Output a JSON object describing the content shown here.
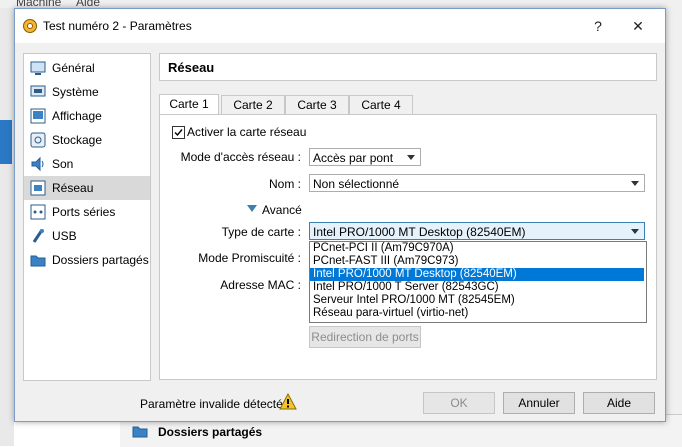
{
  "background_app": {
    "menu_items": [
      "Machine",
      "Aide"
    ],
    "list_footer_item": "Dossiers partagés"
  },
  "dialog": {
    "title": "Test numéro 2 - Paramètres",
    "help_button": "?",
    "close_button": "✕"
  },
  "sidebar": {
    "items": [
      {
        "label": "Général",
        "icon": "general-icon",
        "selected": false
      },
      {
        "label": "Système",
        "icon": "system-icon",
        "selected": false
      },
      {
        "label": "Affichage",
        "icon": "display-icon",
        "selected": false
      },
      {
        "label": "Stockage",
        "icon": "storage-icon",
        "selected": false
      },
      {
        "label": "Son",
        "icon": "sound-icon",
        "selected": false
      },
      {
        "label": "Réseau",
        "icon": "network-icon",
        "selected": true
      },
      {
        "label": "Ports séries",
        "icon": "serial-port-icon",
        "selected": false
      },
      {
        "label": "USB",
        "icon": "usb-icon",
        "selected": false
      },
      {
        "label": "Dossiers partagés",
        "icon": "shared-folder-icon",
        "selected": false
      }
    ]
  },
  "panel": {
    "title": "Réseau",
    "tabs": [
      {
        "label": "Carte 1",
        "active": true
      },
      {
        "label": "Carte 2",
        "active": false
      },
      {
        "label": "Carte 3",
        "active": false
      },
      {
        "label": "Carte 4",
        "active": false
      }
    ],
    "enable_checkbox": {
      "label": "Activer la carte réseau",
      "checked": true
    },
    "access_mode": {
      "label": "Mode d'accès réseau :",
      "value": "Accès par pont"
    },
    "name": {
      "label": "Nom :",
      "value": "Non sélectionné"
    },
    "advanced": {
      "label": "Avancé"
    },
    "card_type": {
      "label": "Type de carte :",
      "value": "Intel PRO/1000 MT Desktop (82540EM)",
      "options": [
        "PCnet-PCI II (Am79C970A)",
        "PCnet-FAST III (Am79C973)",
        "Intel PRO/1000 MT Desktop (82540EM)",
        "Intel PRO/1000 T Server (82543GC)",
        "Serveur Intel PRO/1000 MT (82545EM)",
        "Réseau para-virtuel (virtio-net)"
      ],
      "selected_index": 2
    },
    "promiscuous": {
      "label": "Mode Promiscuité :"
    },
    "mac": {
      "label": "Adresse MAC :"
    },
    "port_forwarding_button": "Redirection de ports"
  },
  "footer": {
    "warning_text": "Paramètre invalide détecté",
    "ok": "OK",
    "cancel": "Annuler",
    "help": "Aide"
  },
  "colors": {
    "selection": "#0078d7",
    "sidebar_selected": "#d9d9d9",
    "accent": "#3c7fb1"
  }
}
